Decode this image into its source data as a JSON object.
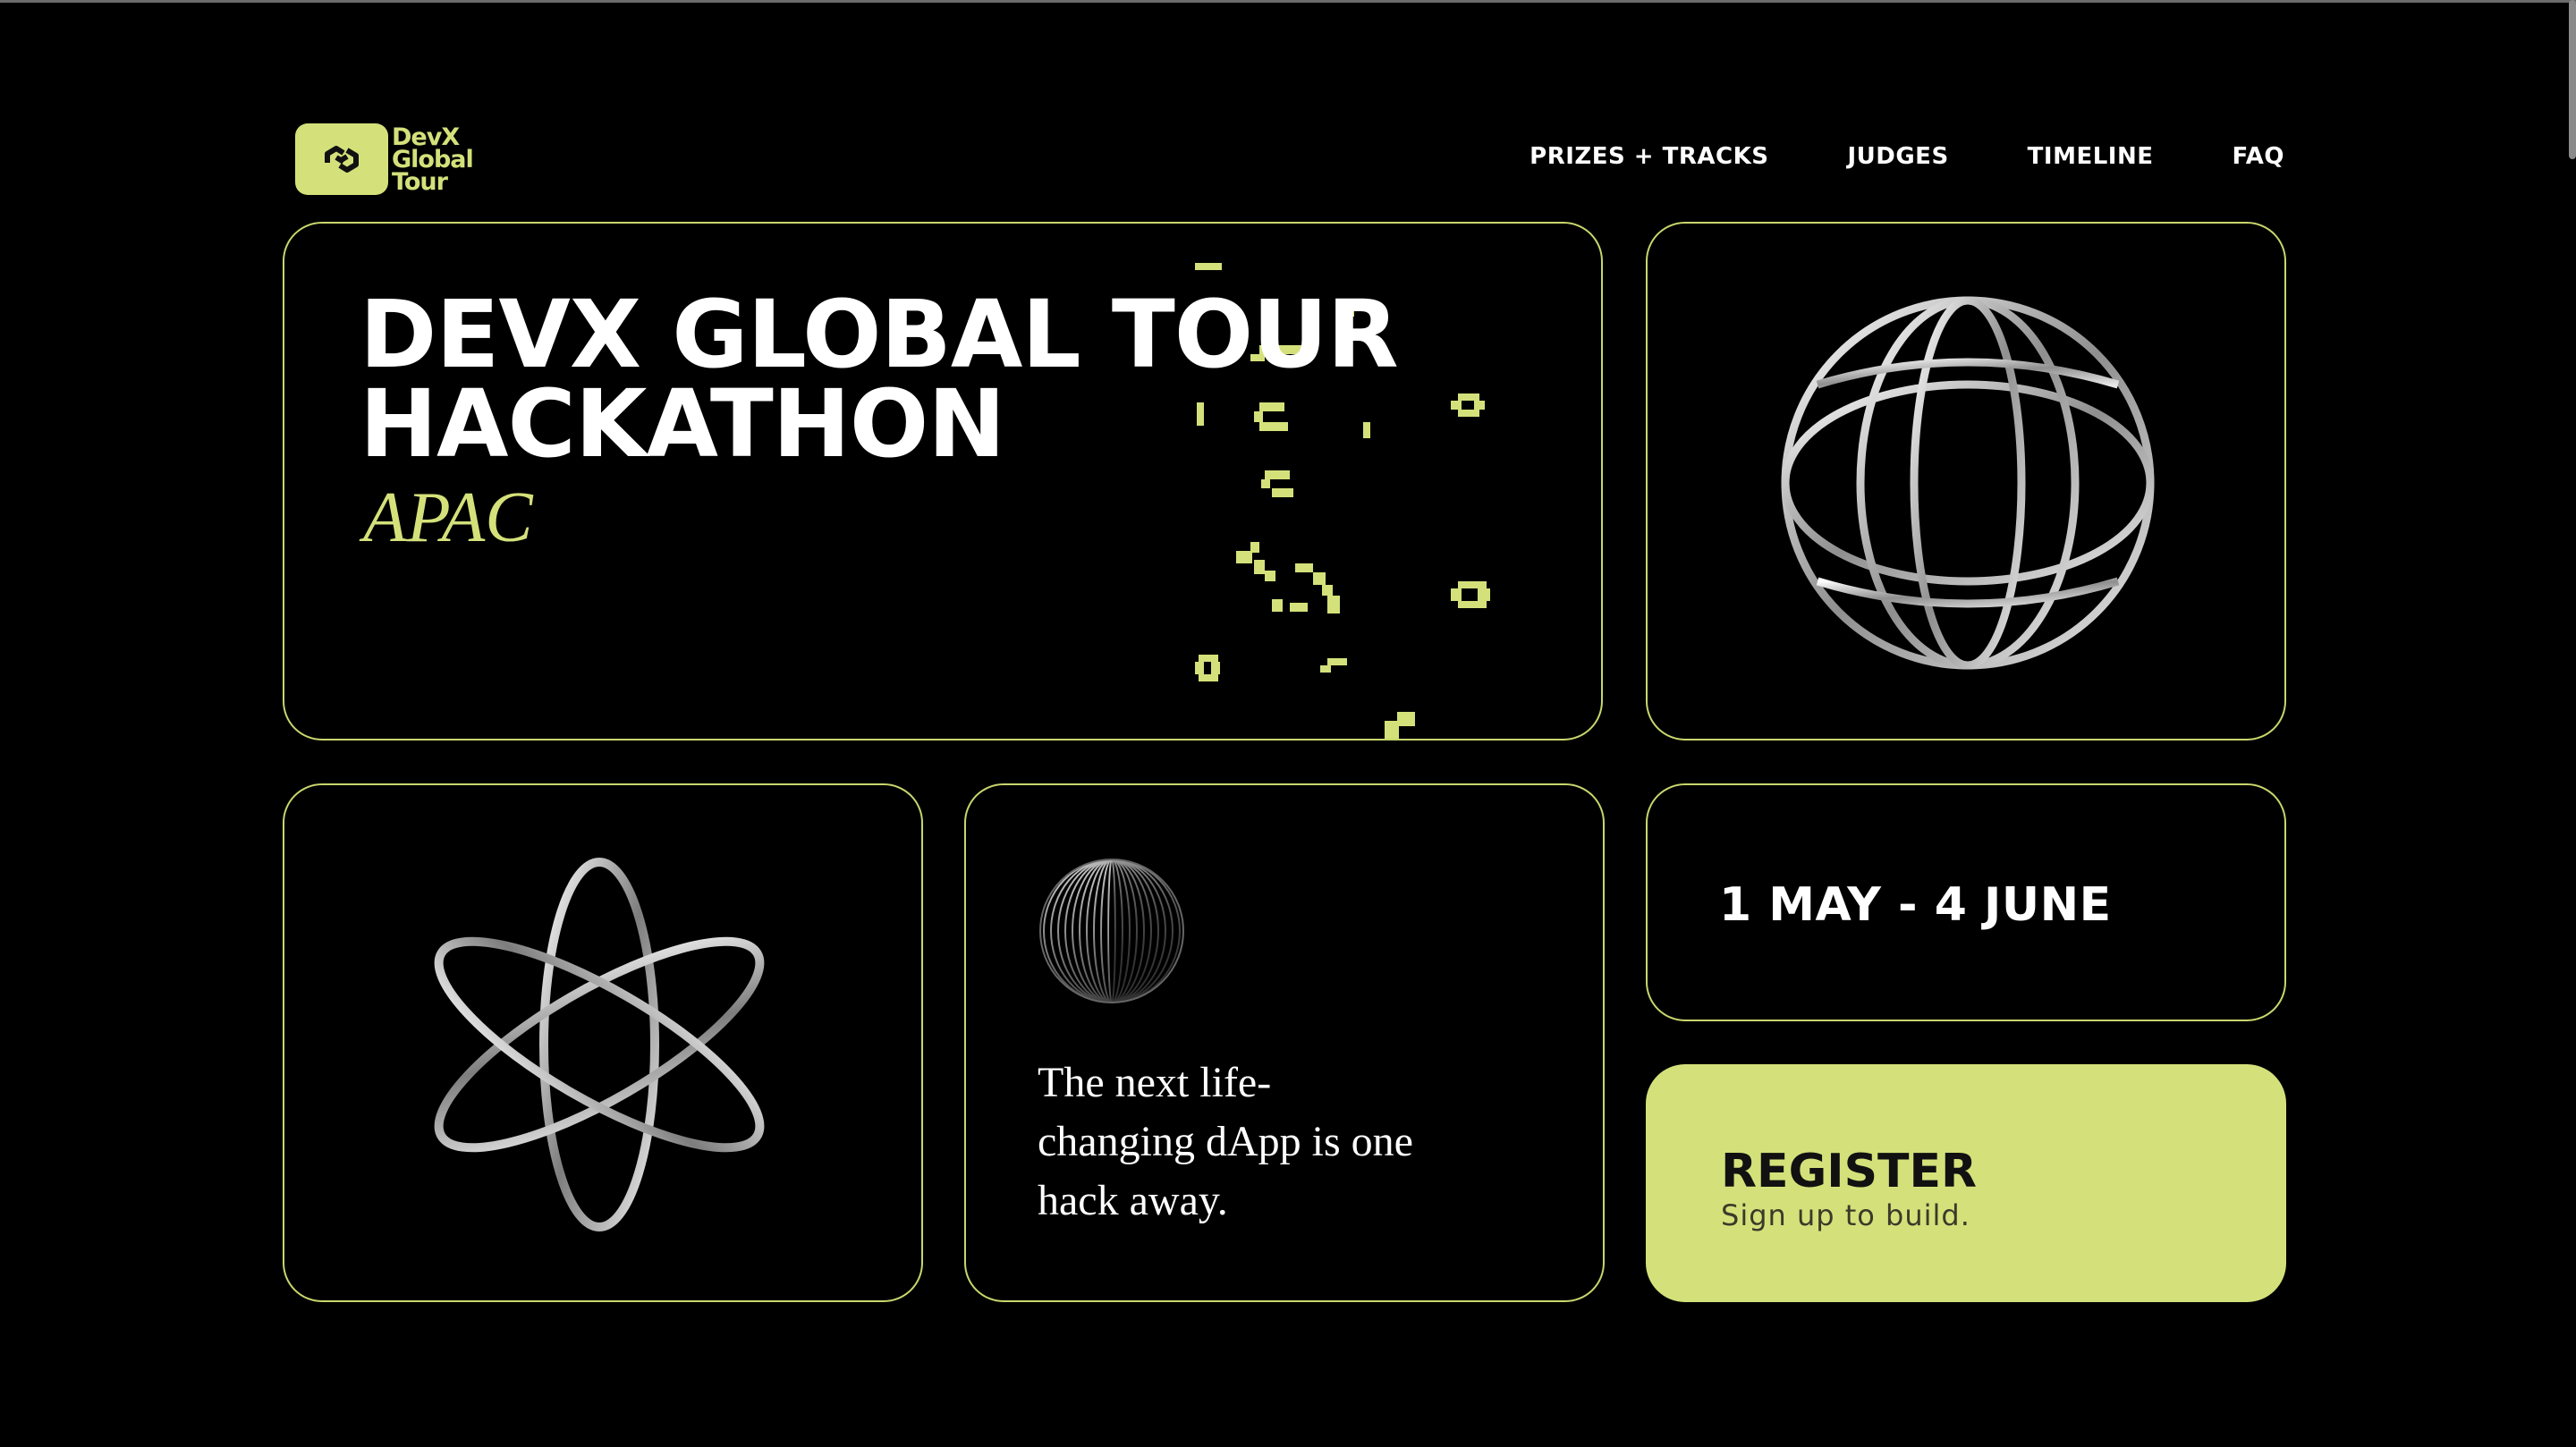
{
  "brand": {
    "logo_text": [
      "DevX",
      "Global",
      "Tour"
    ],
    "accent_color": "#d4e17a",
    "background_color": "#000000"
  },
  "nav": {
    "items": [
      {
        "label": "PRIZES + TRACKS"
      },
      {
        "label": "JUDGES"
      },
      {
        "label": "TIMELINE"
      },
      {
        "label": "FAQ"
      }
    ]
  },
  "hero": {
    "title_line1": "DEVX GLOBAL TOUR",
    "title_line2": "HACKATHON",
    "region": "APAC"
  },
  "globe_card": {
    "icon": "wireframe-globe-icon"
  },
  "atom_card": {
    "icon": "atom-icon"
  },
  "tagline_card": {
    "icon": "striped-sphere-icon",
    "text": "The next life-changing dApp is one hack away."
  },
  "date_card": {
    "dates": "1 MAY - 4 JUNE"
  },
  "register": {
    "label": "REGISTER",
    "sublabel": "Sign up to build."
  }
}
